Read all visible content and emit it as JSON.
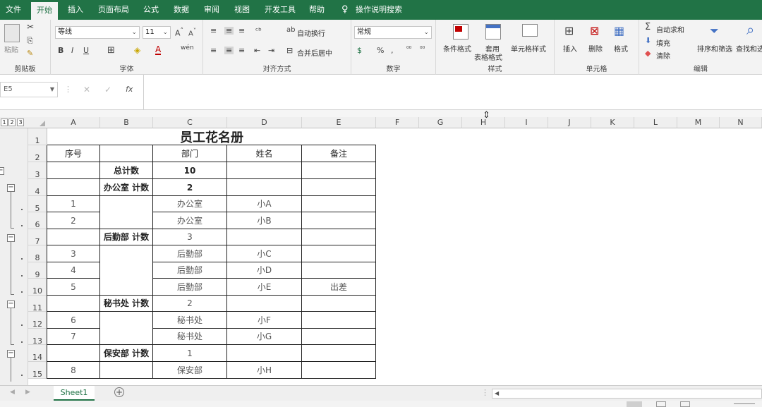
{
  "menu": {
    "tabs": [
      "文件",
      "开始",
      "插入",
      "页面布局",
      "公式",
      "数据",
      "审阅",
      "视图",
      "开发工具",
      "帮助"
    ],
    "tell_me": "操作说明搜索"
  },
  "ribbon": {
    "clipboard": {
      "paste": "粘贴",
      "label": "剪贴板"
    },
    "font": {
      "name": "等线",
      "size": "11",
      "label": "字体"
    },
    "align": {
      "wrap": "自动换行",
      "merge": "合并后居中",
      "label": "对齐方式"
    },
    "number": {
      "format": "常规",
      "label": "数字"
    },
    "styles": {
      "cond": "条件格式",
      "table_a": "套用",
      "table_b": "表格格式",
      "cellstyle": "单元格样式",
      "label": "样式"
    },
    "cells": {
      "insert": "插入",
      "delete": "删除",
      "format": "格式",
      "label": "单元格"
    },
    "editing": {
      "autosum": "自动求和",
      "fill": "填充",
      "clear": "清除",
      "sort": "排序和筛选",
      "find": "查找和选择",
      "label": "编辑"
    }
  },
  "formula_bar": {
    "name_box": "E5",
    "fx": "fx",
    "value": ""
  },
  "outline_levels": [
    "1",
    "2",
    "3"
  ],
  "columns": [
    "A",
    "B",
    "C",
    "D",
    "E",
    "F",
    "G",
    "H",
    "I",
    "J",
    "K",
    "L",
    "M",
    "N"
  ],
  "rows": [
    "1",
    "2",
    "3",
    "4",
    "5",
    "6",
    "7",
    "8",
    "9",
    "10",
    "11",
    "12",
    "13",
    "14",
    "15"
  ],
  "table": {
    "title": "员工花名册",
    "headers": [
      "序号",
      "",
      "部门",
      "姓名",
      "备注"
    ],
    "subtotal_label": "总计数",
    "subtotal_value": "10",
    "groups": [
      {
        "label": "办公室 计数",
        "count": "2"
      },
      {
        "label": "后勤部 计数",
        "count": "3"
      },
      {
        "label": "秘书处 计数",
        "count": "2"
      },
      {
        "label": "保安部 计数",
        "count": "1"
      }
    ],
    "data": [
      {
        "no": "1",
        "dept": "办公室",
        "name": "小A",
        "note": ""
      },
      {
        "no": "2",
        "dept": "办公室",
        "name": "小B",
        "note": ""
      },
      {
        "no": "3",
        "dept": "后勤部",
        "name": "小C",
        "note": ""
      },
      {
        "no": "4",
        "dept": "后勤部",
        "name": "小D",
        "note": ""
      },
      {
        "no": "5",
        "dept": "后勤部",
        "name": "小E",
        "note": "出差"
      },
      {
        "no": "6",
        "dept": "秘书处",
        "name": "小F",
        "note": ""
      },
      {
        "no": "7",
        "dept": "秘书处",
        "name": "小G",
        "note": ""
      },
      {
        "no": "8",
        "dept": "保安部",
        "name": "小H",
        "note": ""
      }
    ]
  },
  "sheet_tabs": [
    "Sheet1"
  ],
  "colors": {
    "brand": "#217346",
    "ribbon": "#f3f3f3",
    "header": "#efefef"
  }
}
